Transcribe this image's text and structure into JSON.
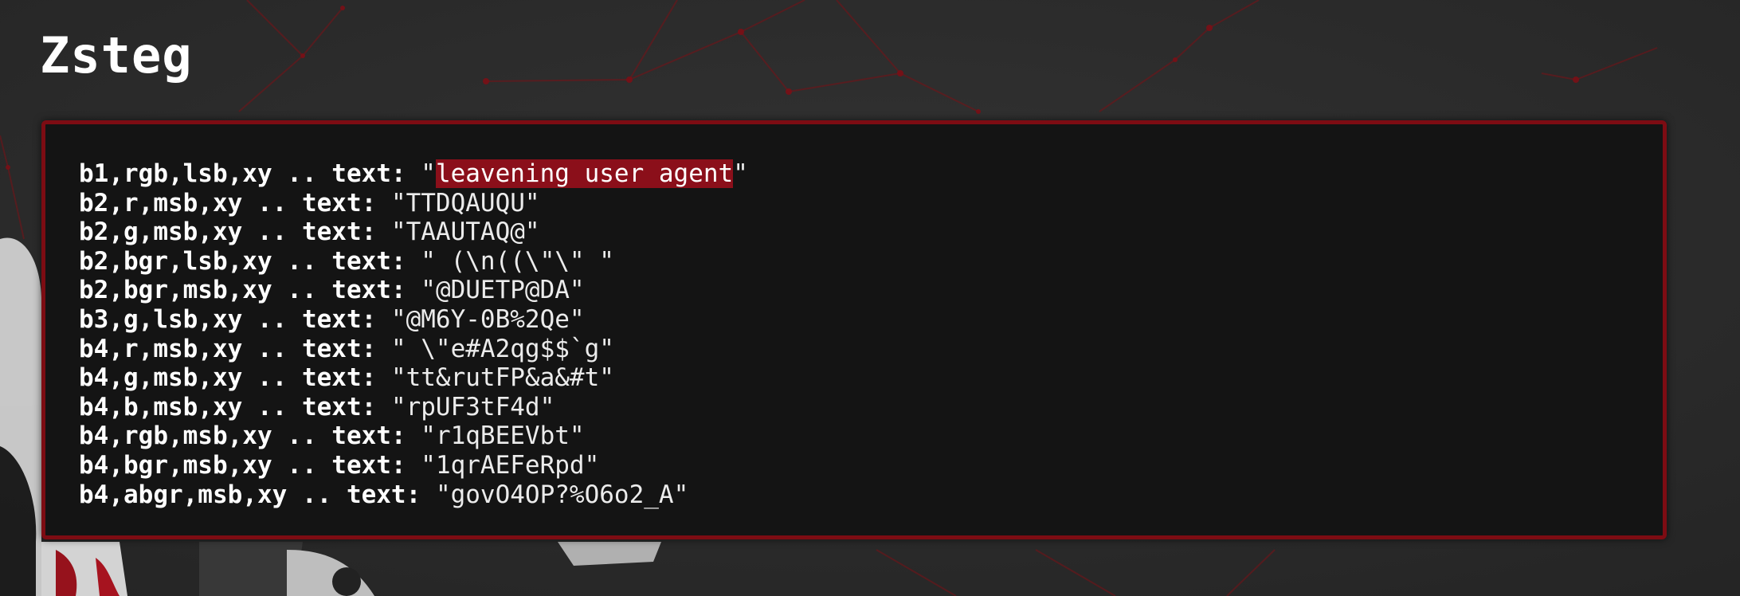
{
  "page": {
    "title": "Zsteg",
    "colors": {
      "background": "#2b2b2b",
      "accent": "#7d0c13",
      "terminal_background": "#141414",
      "highlight": "#8b0f1a"
    }
  },
  "terminal": {
    "lines": [
      {
        "key": "b1,rgb,lsb,xy .. text: ",
        "open": "\"",
        "highlight": "leavening user agent",
        "value": "",
        "close": "\""
      },
      {
        "key": "b2,r,msb,xy .. text: ",
        "open": "\"",
        "highlight": "",
        "value": "TTDQAUQU",
        "close": "\""
      },
      {
        "key": "b2,g,msb,xy .. text: ",
        "open": "\"",
        "highlight": "",
        "value": "TAAUTAQ@",
        "close": "\""
      },
      {
        "key": "b2,bgr,lsb,xy .. text: ",
        "open": "\"",
        "highlight": "",
        "value": " (\\n((\\\"\\\" ",
        "close": "\""
      },
      {
        "key": "b2,bgr,msb,xy .. text: ",
        "open": "\"",
        "highlight": "",
        "value": "@DUETP@DA",
        "close": "\""
      },
      {
        "key": "b3,g,lsb,xy .. text: ",
        "open": "\"",
        "highlight": "",
        "value": "@M6Y-0B%2Qe",
        "close": "\""
      },
      {
        "key": "b4,r,msb,xy .. text: ",
        "open": "\"",
        "highlight": "",
        "value": " \\\"e#A2qg$$`g",
        "close": "\""
      },
      {
        "key": "b4,g,msb,xy .. text: ",
        "open": "\"",
        "highlight": "",
        "value": "tt&rutFP&a&#t",
        "close": "\""
      },
      {
        "key": "b4,b,msb,xy .. text: ",
        "open": "\"",
        "highlight": "",
        "value": "rpUF3tF4d",
        "close": "\""
      },
      {
        "key": "b4,rgb,msb,xy .. text: ",
        "open": "\"",
        "highlight": "",
        "value": "r1qBEEVbt",
        "close": "\""
      },
      {
        "key": "b4,bgr,msb,xy .. text: ",
        "open": "\"",
        "highlight": "",
        "value": "1qrAEFeRpd",
        "close": "\""
      },
      {
        "key": "b4,abgr,msb,xy .. text: ",
        "open": "\"",
        "highlight": "",
        "value": "govO4OP?%O6o2_A",
        "close": "\""
      }
    ]
  }
}
